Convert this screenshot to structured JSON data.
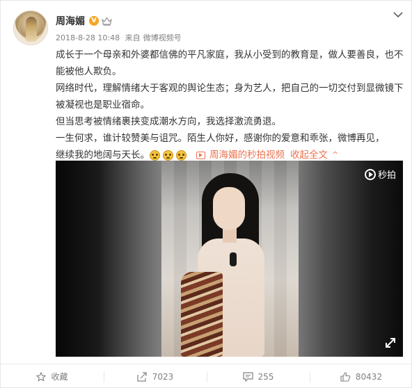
{
  "post": {
    "author": "周海媚",
    "date": "2018-8-28 10:48",
    "source_prefix": "来自",
    "source": "微博视频号",
    "verified_badge": "V",
    "paragraphs": [
      "成长于一个母亲和外婆都信佛的平凡家庭，我从小受到的教育是，做人要善良，也不能被他人欺负。",
      "网络时代，理解情绪大于客观的舆论生态；身为艺人，把自己的一切交付到显微镜下被凝视也是职业宿命。",
      "但当思考被情绪裹挟变成潮水方向，我选择激流勇退。",
      "一生何求，谁计较赞美与诅咒。陌生人你好，感谢你的爱意和乖张，微博再见，"
    ],
    "last_line": "继续我的地阔与天长。",
    "video_link": "周海媚的秒拍视频",
    "collapse_link": "收起全文",
    "video_brand": "秒拍"
  },
  "actions": {
    "favorite": "收藏",
    "repost": "7023",
    "comment": "255",
    "like": "80432"
  },
  "colors": {
    "link": "#eb7350",
    "meta": "#808080",
    "badge": "#f5a623"
  }
}
